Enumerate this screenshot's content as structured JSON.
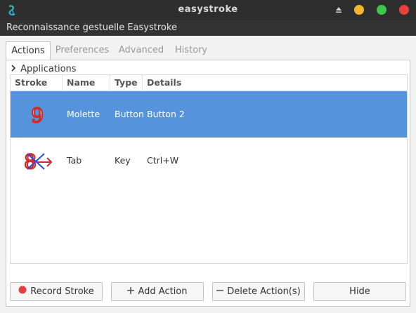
{
  "window": {
    "title": "easystroke",
    "subtitle": "Reconnaissance gestuelle Easystroke"
  },
  "tabs": [
    {
      "label": "Actions",
      "active": true
    },
    {
      "label": "Preferences",
      "active": false
    },
    {
      "label": "Advanced",
      "active": false
    },
    {
      "label": "History",
      "active": false
    }
  ],
  "applications_label": "Applications",
  "table": {
    "columns": [
      "Stroke",
      "Name",
      "Type",
      "Details"
    ],
    "rows": [
      {
        "stroke_glyph": "9",
        "name": "Molette",
        "type": "Button",
        "details": "Button 2",
        "selected": true
      },
      {
        "stroke_glyph": "8",
        "name": "Tab",
        "type": "Key",
        "details": "Ctrl+W",
        "selected": false
      }
    ]
  },
  "buttons": {
    "record": "Record Stroke",
    "add": "Add Action",
    "delete": "Delete Action(s)",
    "hide": "Hide"
  },
  "colors": {
    "selection": "#5594dc",
    "minimize": "#f2b630",
    "maximize": "#3fc44c",
    "close": "#e64040",
    "record_dot": "#e24040",
    "stroke_red": "#d32a2a",
    "stroke_blue": "#2a4bd3"
  }
}
